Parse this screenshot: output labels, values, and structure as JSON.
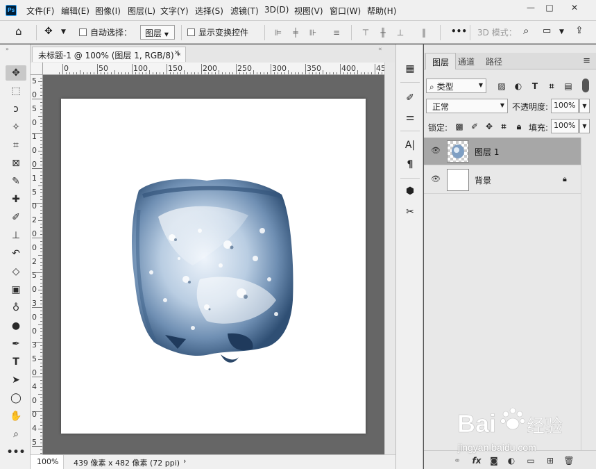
{
  "app": {
    "logo": "Ps"
  },
  "menu": [
    "文件(F)",
    "编辑(E)",
    "图像(I)",
    "图层(L)",
    "文字(Y)",
    "选择(S)",
    "滤镜(T)",
    "3D(D)",
    "视图(V)",
    "窗口(W)",
    "帮助(H)"
  ],
  "window_controls": {
    "minimize": "—",
    "maximize": "□",
    "close": "✕"
  },
  "options_bar": {
    "auto_select_label": "自动选择：",
    "auto_select_target": "图层",
    "show_transform_label": "显示变换控件",
    "mode_3d_label": "3D 模式：",
    "more": "•••"
  },
  "document": {
    "tab_title": "未标题-1 @ 100% (图层 1, RGB/8) *",
    "ruler_h": [
      "0",
      "50",
      "100",
      "150",
      "200",
      "250",
      "300",
      "350",
      "400",
      "45"
    ],
    "ruler_v": [
      "5",
      "0",
      "5",
      "0",
      "1",
      "0",
      "0",
      "1",
      "5",
      "0",
      "2",
      "0",
      "0",
      "2",
      "5",
      "0",
      "3",
      "0",
      "0",
      "3",
      "5",
      "0",
      "4",
      "0",
      "0",
      "4",
      "5"
    ],
    "status_zoom": "100%",
    "status_info": "439 像素 x 482 像素 (72 ppi)",
    "status_arrow": "›"
  },
  "layers_panel": {
    "tabs": [
      "图层",
      "通道",
      "路径"
    ],
    "filter_label": "类型",
    "blend_mode": "正常",
    "opacity_label": "不透明度:",
    "opacity_value": "100%",
    "lock_label": "锁定:",
    "fill_label": "填充:",
    "fill_value": "100%",
    "layers": [
      {
        "name": "图层 1",
        "selected": true
      },
      {
        "name": "背景",
        "selected": false,
        "locked": true
      }
    ],
    "footer_icons": [
      "link-icon",
      "fx-icon",
      "mask-icon",
      "adjustment-icon",
      "folder-icon",
      "new-layer-icon",
      "trash-icon"
    ]
  },
  "watermark": {
    "brand": "Bai",
    "brand2": "经验",
    "url": "jingyan.baidu.com"
  },
  "colors": {
    "canvas_bg": "#666666",
    "selected_layer": "#a7a7a7",
    "ice": "#4a6e96"
  }
}
